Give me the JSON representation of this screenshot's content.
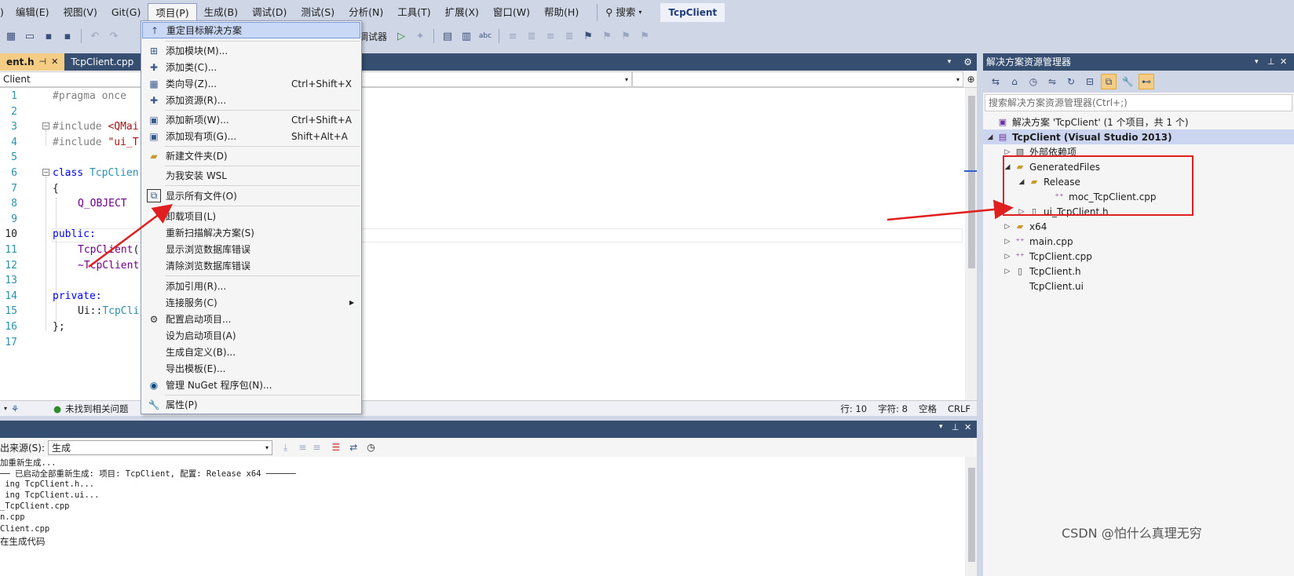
{
  "menubar": {
    "items": [
      "编辑(E)",
      "视图(V)",
      "Git(G)",
      "项目(P)",
      "生成(B)",
      "调试(D)",
      "测试(S)",
      "分析(N)",
      "工具(T)",
      "扩展(X)",
      "窗口(W)",
      "帮助(H)"
    ],
    "search_label": "搜索",
    "solution_name": "TcpClient"
  },
  "toolbar": {
    "debugger_label": "调试器"
  },
  "editor": {
    "tabs": [
      {
        "label": "ent.h",
        "active": true
      },
      {
        "label": "TcpClient.cpp",
        "active": false
      }
    ],
    "nav_scope": "Client",
    "line_numbers": [
      "1",
      "2",
      "3",
      "4",
      "5",
      "6",
      "7",
      "8",
      "9",
      "10",
      "11",
      "12",
      "13",
      "14",
      "15",
      "16",
      "17"
    ],
    "code": {
      "l1": "#pragma once",
      "l3_a": "#include ",
      "l3_b": "<QMai",
      "l4_a": "#include ",
      "l4_b": "\"ui_T",
      "l6_a": "class ",
      "l6_b": "TcpClien",
      "l7": "{",
      "l8": "Q_OBJECT",
      "l10": "public:",
      "l11_a": "TcpClient",
      "l11_b": "(",
      "l12": "~TcpClient",
      "l14": "private:",
      "l15_a": "Ui::",
      "l15_b": "TcpCli",
      "l16": "};"
    },
    "status": {
      "issues": "未找到相关问题",
      "line": "行: 10",
      "char": "字符: 8",
      "space": "空格",
      "eol": "CRLF"
    }
  },
  "project_menu": {
    "items": [
      {
        "label": "重定目标解决方案",
        "shortcut": "",
        "icon": "↑",
        "highlight": true
      },
      {
        "label": "添加模块(M)...",
        "shortcut": "",
        "icon": "⊞"
      },
      {
        "label": "添加类(C)...",
        "shortcut": "",
        "icon": "✚"
      },
      {
        "label": "类向导(Z)...",
        "shortcut": "Ctrl+Shift+X",
        "icon": "▦"
      },
      {
        "label": "添加资源(R)...",
        "shortcut": "",
        "icon": "✚"
      },
      {
        "label": "添加新项(W)...",
        "shortcut": "Ctrl+Shift+A",
        "icon": "▣"
      },
      {
        "label": "添加现有项(G)...",
        "shortcut": "Shift+Alt+A",
        "icon": "▣"
      },
      {
        "label": "新建文件夹(D)",
        "shortcut": "",
        "icon": "▰"
      },
      {
        "label": "为我安装 WSL",
        "shortcut": "",
        "icon": ""
      },
      {
        "label": "显示所有文件(O)",
        "shortcut": "",
        "icon": "⧉"
      },
      {
        "label": "卸载项目(L)",
        "shortcut": "",
        "icon": ""
      },
      {
        "label": "重新扫描解决方案(S)",
        "shortcut": "",
        "icon": ""
      },
      {
        "label": "显示浏览数据库错误",
        "shortcut": "",
        "icon": ""
      },
      {
        "label": "清除浏览数据库错误",
        "shortcut": "",
        "icon": ""
      },
      {
        "label": "添加引用(R)...",
        "shortcut": "",
        "icon": ""
      },
      {
        "label": "连接服务(C)",
        "shortcut": "",
        "icon": "",
        "submenu": true
      },
      {
        "label": "配置启动项目...",
        "shortcut": "",
        "icon": "⚙"
      },
      {
        "label": "设为启动项目(A)",
        "shortcut": "",
        "icon": ""
      },
      {
        "label": "生成自定义(B)...",
        "shortcut": "",
        "icon": ""
      },
      {
        "label": "导出模板(E)...",
        "shortcut": "",
        "icon": ""
      },
      {
        "label": "管理 NuGet 程序包(N)...",
        "shortcut": "",
        "icon": "◉"
      },
      {
        "label": "属性(P)",
        "shortcut": "",
        "icon": "🔧"
      }
    ]
  },
  "output": {
    "source_label": "出来源(S):",
    "source_value": "生成",
    "lines": [
      "加重新生成...",
      "── 已启动全部重新生成: 项目: TcpClient, 配置: Release x64 ──────",
      " ing TcpClient.h...",
      " ing TcpClient.ui...",
      "_TcpClient.cpp",
      "n.cpp",
      "Client.cpp",
      "在生成代码"
    ]
  },
  "solution_explorer": {
    "title": "解决方案资源管理器",
    "search_placeholder": "搜索解决方案资源管理器(Ctrl+;)",
    "tree": [
      {
        "label": "解决方案 'TcpClient' (1 个项目，共 1 个)",
        "indent": 0,
        "icon": "sln",
        "toggle": ""
      },
      {
        "label": "TcpClient (Visual Studio 2013)",
        "indent": 0,
        "icon": "proj",
        "toggle": "▲",
        "selected": true
      },
      {
        "label": "外部依赖项",
        "indent": 1,
        "icon": "dep",
        "toggle": "▷"
      },
      {
        "label": "GeneratedFiles",
        "indent": 1,
        "icon": "folder",
        "toggle": "◢"
      },
      {
        "label": "Release",
        "indent": 2,
        "icon": "folder",
        "toggle": "◢"
      },
      {
        "label": "moc_TcpClient.cpp",
        "indent": 3,
        "icon": "cpp",
        "toggle": ""
      },
      {
        "label": "ui_TcpClient.h",
        "indent": 2,
        "icon": "h",
        "toggle": "▷"
      },
      {
        "label": "x64",
        "indent": 1,
        "icon": "folder",
        "toggle": "▷"
      },
      {
        "label": "main.cpp",
        "indent": 1,
        "icon": "cpp",
        "toggle": "▷"
      },
      {
        "label": "TcpClient.cpp",
        "indent": 1,
        "icon": "cpp",
        "toggle": "▷"
      },
      {
        "label": "TcpClient.h",
        "indent": 1,
        "icon": "h",
        "toggle": "▷"
      },
      {
        "label": "TcpClient.ui",
        "indent": 1,
        "icon": "",
        "toggle": ""
      }
    ]
  },
  "watermark": "CSDN @怕什么真理无穷",
  "colors": {
    "annotation_red": "#e02020",
    "tab_active": "#f5cc84",
    "title_bar": "#364e6f"
  }
}
